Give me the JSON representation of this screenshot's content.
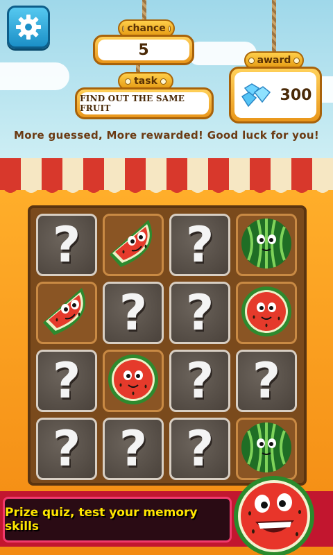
{
  "hud": {
    "chance_label": "chance",
    "chance_value": "5",
    "task_label": "task",
    "task_value": "FIND OUT THE SAME FRUIT",
    "award_label": "award",
    "award_value": "300",
    "award_icon": "diamond-icon",
    "settings_icon": "gear-icon"
  },
  "message": "More guessed, More rewarded! Good luck for you!",
  "board": {
    "cards": [
      {
        "state": "hidden",
        "fruit": "question"
      },
      {
        "state": "open",
        "fruit": "watermelon-slice"
      },
      {
        "state": "hidden",
        "fruit": "question"
      },
      {
        "state": "open",
        "fruit": "whole-watermelon"
      },
      {
        "state": "open",
        "fruit": "watermelon-slice"
      },
      {
        "state": "hidden",
        "fruit": "question"
      },
      {
        "state": "hidden",
        "fruit": "question"
      },
      {
        "state": "open",
        "fruit": "watermelon-half"
      },
      {
        "state": "hidden",
        "fruit": "question"
      },
      {
        "state": "open",
        "fruit": "watermelon-half"
      },
      {
        "state": "hidden",
        "fruit": "question"
      },
      {
        "state": "hidden",
        "fruit": "question"
      },
      {
        "state": "hidden",
        "fruit": "question"
      },
      {
        "state": "hidden",
        "fruit": "question"
      },
      {
        "state": "hidden",
        "fruit": "question"
      },
      {
        "state": "open",
        "fruit": "whole-watermelon"
      }
    ],
    "hidden_symbol": "?"
  },
  "banner": {
    "text": "Prize quiz, test your memory skills",
    "mascot": "watermelon-mascot-icon"
  },
  "colors": {
    "accent_orange": "#f39a16",
    "panel_border": "#a8620a",
    "banner_red": "#c2162f",
    "banner_text": "#ffe600"
  }
}
